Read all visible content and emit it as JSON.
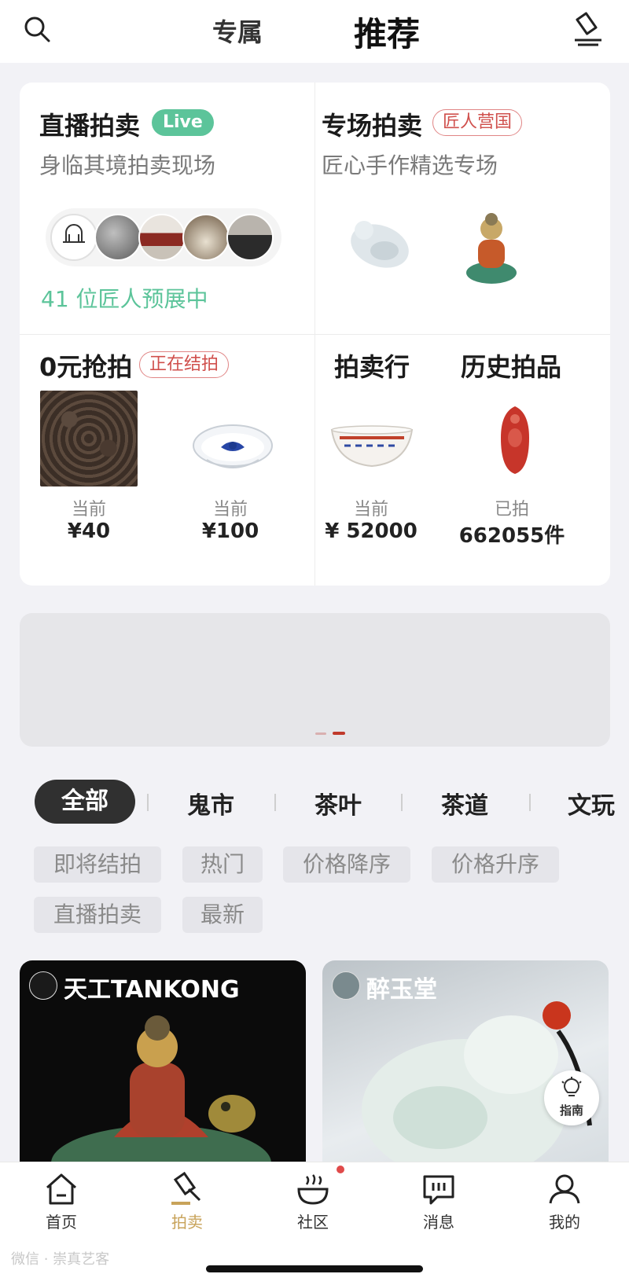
{
  "header": {
    "tab_exclusive": "专属",
    "tab_recommend": "推荐"
  },
  "live_auction": {
    "title": "直播拍卖",
    "badge": "Live",
    "subtitle": "身临其境拍卖现场",
    "preview_count": "41 位匠人预展中"
  },
  "special_auction": {
    "title": "专场拍卖",
    "badge": "匠人营国",
    "subtitle": "匠心手作精选专场"
  },
  "zero_auction": {
    "title": "0元抢拍",
    "badge": "正在结拍",
    "items": [
      {
        "label": "当前",
        "price": "¥40"
      },
      {
        "label": "当前",
        "price": "¥100"
      }
    ]
  },
  "auction_house": {
    "title": "拍卖行",
    "label": "当前",
    "price": "¥ 52000"
  },
  "history": {
    "title": "历史拍品",
    "label": "已拍",
    "count": "662055件"
  },
  "categories": {
    "active": "全部",
    "items": [
      "鬼市",
      "茶叶",
      "茶道",
      "文玩"
    ]
  },
  "filters": [
    "即将结拍",
    "热门",
    "价格降序",
    "价格升序",
    "直播拍卖",
    "最新"
  ],
  "feed": [
    {
      "store": "天工TANKONG"
    },
    {
      "store": "醉玉堂"
    }
  ],
  "guide_label": "指南",
  "tabbar": [
    {
      "label": "首页",
      "icon": "home-icon"
    },
    {
      "label": "拍卖",
      "icon": "gavel-icon",
      "active": true
    },
    {
      "label": "社区",
      "icon": "community-icon"
    },
    {
      "label": "消息",
      "icon": "message-icon"
    },
    {
      "label": "我的",
      "icon": "profile-icon"
    }
  ],
  "watermark": "微信 · 崇真艺客",
  "colors": {
    "accent_green": "#5cc49a",
    "accent_red": "#d0504d",
    "tab_active": "#c8a35a"
  }
}
